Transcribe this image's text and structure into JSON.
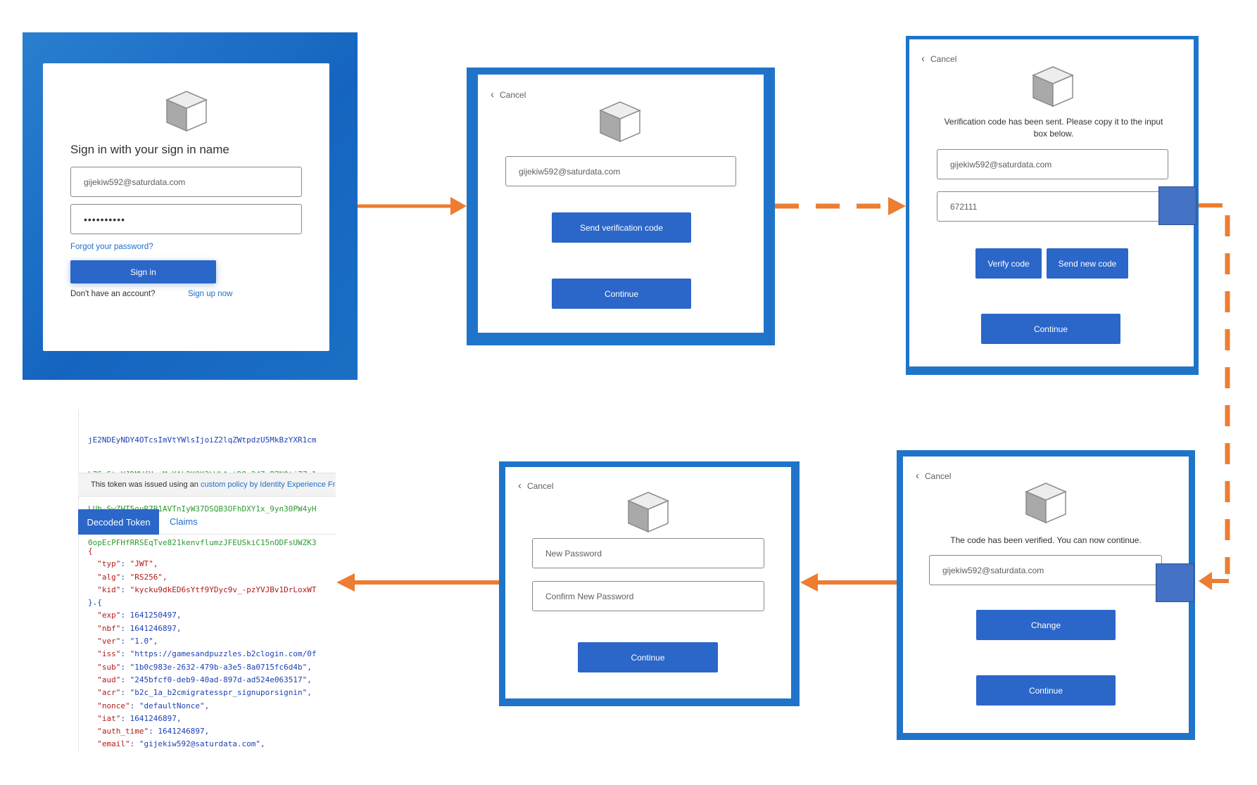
{
  "panel1": {
    "title": "Sign in with your sign in name",
    "email_value": "gijekiw592@saturdata.com",
    "password_value": "••••••••••",
    "forgot_link": "Forgot your password?",
    "sign_in_button": "Sign in",
    "no_account_text": "Don't have an account?",
    "sign_up_link": "Sign up now"
  },
  "panel2": {
    "cancel": "Cancel",
    "email_value": "gijekiw592@saturdata.com",
    "send_code_button": "Send verification code",
    "continue_button": "Continue"
  },
  "panel3": {
    "cancel": "Cancel",
    "message": "Verification code has been sent. Please copy it to the input box below.",
    "email_value": "gijekiw592@saturdata.com",
    "code_value": "672111",
    "verify_button": "Verify code",
    "send_new_button": "Send new code",
    "continue_button": "Continue"
  },
  "panel4": {
    "cancel": "Cancel",
    "message": "The code has been verified. You can now continue.",
    "email_value": "gijekiw592@saturdata.com",
    "change_button": "Change",
    "continue_button": "Continue"
  },
  "panel5": {
    "cancel": "Cancel",
    "new_password_placeholder": "New Password",
    "confirm_password_placeholder": "Confirm New Password",
    "continue_button": "Continue"
  },
  "token_panel": {
    "encoded_lines": [
      {
        "text": "jE2NDEyNDY4OTcsImVtYWlsIjoiZ2lqZWtpdzU5MkBzYXR1cm",
        "color": "blue"
      },
      {
        "text": "b7S_StvYJDMWfHuzMgKAk2KOK3LWLA-tD8q247mP7N0tj7Za1",
        "color": "green"
      },
      {
        "text": "LUb-SwZHT5ouR7B1AVTnIyW37DSQB3OFhDXY1x_9yn30PW4yH",
        "color": "green"
      },
      {
        "text": "0opEcPFHfRRSEqTve821kenvflumzJFEUSkiC15nODFsUWZK3",
        "color": "green"
      }
    ],
    "issued_text": "This token was issued using an",
    "issued_link": "custom policy by Identity Experience Fra",
    "tab_decoded": "Decoded Token",
    "tab_claims": "Claims",
    "decoded_lines": [
      {
        "key": "",
        "value": "{",
        "kind": "brace-red"
      },
      {
        "key": "\"typ\"",
        "value": "\"JWT\",",
        "kind": "str"
      },
      {
        "key": "\"alg\"",
        "value": "\"RS256\",",
        "kind": "str"
      },
      {
        "key": "\"kid\"",
        "value": "\"kycku9dkED6sYtf9YDyc9v_-pzYVJBv1DrLoxWT",
        "kind": "str"
      },
      {
        "key": "",
        "value": "}.{",
        "kind": "brace"
      },
      {
        "key": "\"exp\"",
        "value": "1641250497,",
        "kind": "num"
      },
      {
        "key": "\"nbf\"",
        "value": "1641246897,",
        "kind": "num"
      },
      {
        "key": "\"ver\"",
        "value": "\"1.0\",",
        "kind": "strb"
      },
      {
        "key": "\"iss\"",
        "value": "\"https://gamesandpuzzles.b2clogin.com/0f",
        "kind": "strb"
      },
      {
        "key": "\"sub\"",
        "value": "\"1b0c983e-2632-479b-a3e5-8a0715fc6d4b\",",
        "kind": "strb"
      },
      {
        "key": "\"aud\"",
        "value": "\"245bfcf0-deb9-40ad-897d-ad524e063517\",",
        "kind": "strb"
      },
      {
        "key": "\"acr\"",
        "value": "\"b2c_1a_b2cmigratesspr_signuporsignin\",",
        "kind": "strb"
      },
      {
        "key": "\"nonce\"",
        "value": "\"defaultNonce\",",
        "kind": "strb"
      },
      {
        "key": "\"iat\"",
        "value": "1641246897,",
        "kind": "num"
      },
      {
        "key": "\"auth_time\"",
        "value": "1641246897,",
        "kind": "num"
      },
      {
        "key": "\"email\"",
        "value": "\"gijekiw592@saturdata.com\",",
        "kind": "strb"
      }
    ]
  },
  "colors": {
    "frame_blue": "#1f74c9",
    "button_blue": "#2b66c9",
    "arrow_orange": "#ed7d31",
    "marker_blue": "#4472c4"
  },
  "icons": [
    "cube-icon",
    "chevron-left-icon",
    "arrow-right",
    "arrow-left",
    "dashed-arrow"
  ]
}
